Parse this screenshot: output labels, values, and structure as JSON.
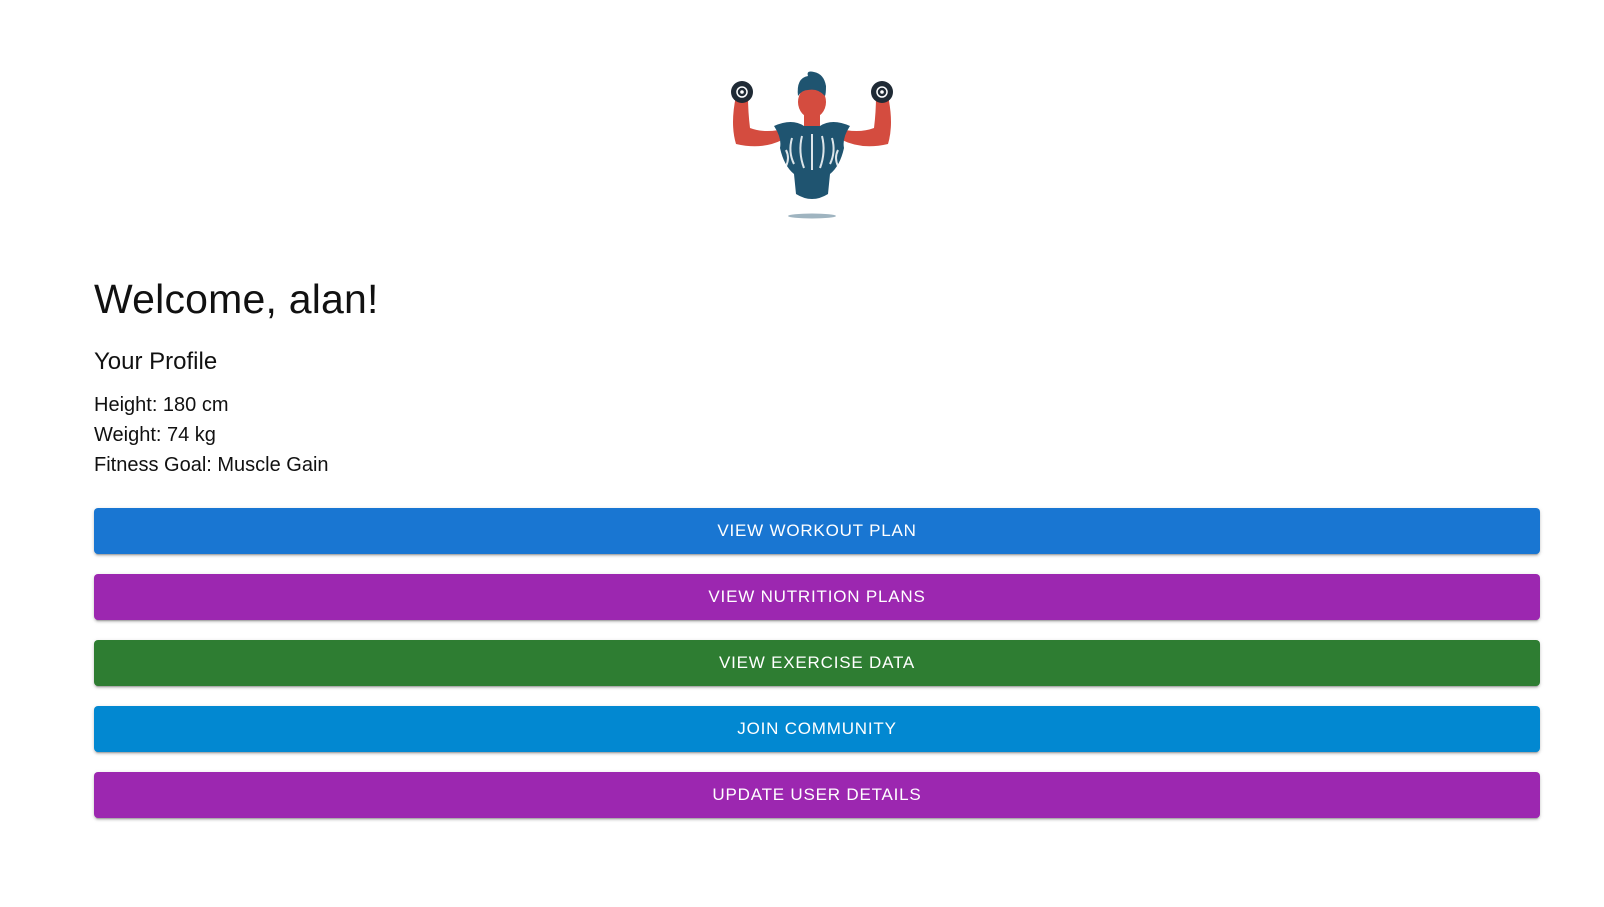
{
  "logo": {
    "icon": "bodybuilder-dumbbells-icon",
    "colors": {
      "skin": "#d44c3f",
      "body": "#1f5470",
      "dumbbell": "#1f2a35"
    }
  },
  "welcome": {
    "text": "Welcome, alan!"
  },
  "profile": {
    "heading": "Your Profile",
    "height": "Height: 180 cm",
    "weight": "Weight: 74 kg",
    "goal": "Fitness Goal: Muscle Gain"
  },
  "actions": {
    "workout": {
      "label": "View Workout Plan",
      "color": "#1976d2"
    },
    "nutrition": {
      "label": "View Nutrition Plans",
      "color": "#9c27b0"
    },
    "exercise": {
      "label": "View Exercise Data",
      "color": "#2e7d32"
    },
    "community": {
      "label": "Join Community",
      "color": "#0288d1"
    },
    "update": {
      "label": "Update User Details",
      "color": "#9c27b0"
    }
  }
}
